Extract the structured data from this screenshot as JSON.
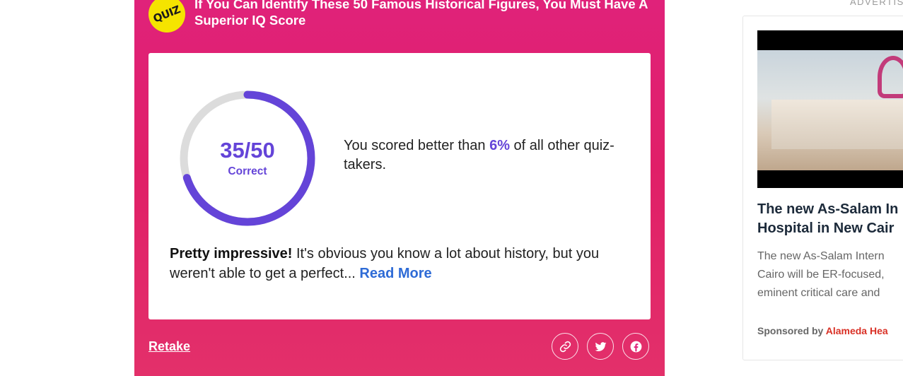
{
  "quiz": {
    "badge": "QUIZ",
    "title": "If You Can Identify These 50 Famous Historical Figures, You Must Have A Superior IQ Score",
    "score": "35/50",
    "score_label": "Correct",
    "score_fraction": 0.7,
    "percentile_prefix": "You scored better than ",
    "percentile_value": "6%",
    "percentile_suffix": " of all other quiz-takers.",
    "result_headline": "Pretty impressive!",
    "result_text": " It's obvious you know a lot about history, but you weren't able to get a perfect... ",
    "read_more": "Read More",
    "retake": "Retake",
    "share_icons": [
      "link-icon",
      "twitter-icon",
      "facebook-icon"
    ]
  },
  "ad": {
    "label": "ADVERTIS",
    "headline_line1": "The new As-Salam In",
    "headline_line2": "Hospital in New Cair",
    "body_line1": "The new As-Salam Intern",
    "body_line2": "Cairo will be ER-focused,",
    "body_line3": "eminent critical care and",
    "sponsored_by": "Sponsored by ",
    "sponsor_name": "Alameda Hea",
    "mute_icon": "mute-icon"
  },
  "colors": {
    "panel": "#e0227a",
    "accent": "#6444d8",
    "ring_track": "#dcdcdc",
    "link": "#2e6bd6",
    "badge": "#f5e400",
    "sponsor": "#d93025"
  }
}
